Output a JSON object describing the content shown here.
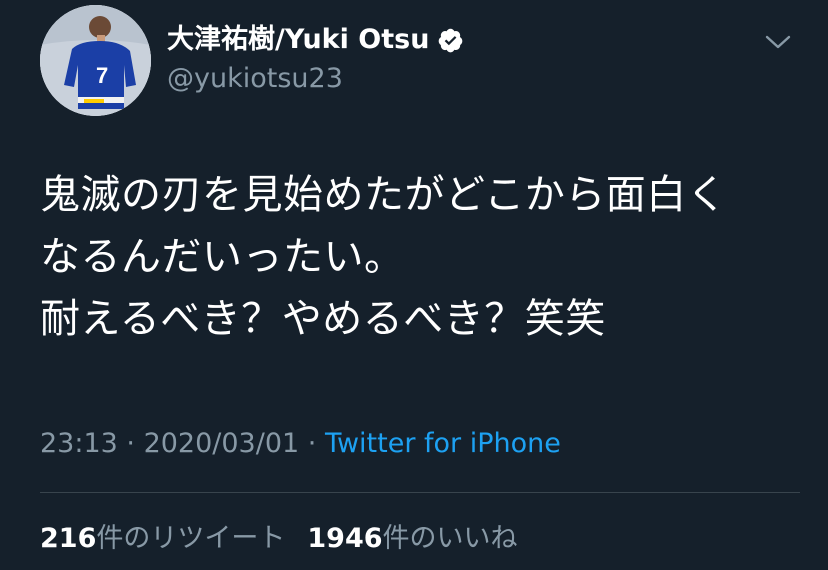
{
  "author": {
    "display_name": "大津祐樹/Yuki Otsu",
    "handle": "@yukiotsu23",
    "verified_icon": "verified-badge-icon",
    "avatar_icon": "player-avatar"
  },
  "tweet": {
    "lines": [
      "鬼滅の刃を見始めたがどこから面白く",
      "なるんだいったい。",
      "耐えるべき？やめるべき？笑笑"
    ]
  },
  "meta": {
    "time": "23:13",
    "sep1": " · ",
    "date": "2020/03/01",
    "sep2": " · ",
    "source": "Twitter for iPhone"
  },
  "stats": {
    "retweets_count": "216",
    "retweets_label": "件のリツイート",
    "likes_count": "1946",
    "likes_label": "件のいいね"
  },
  "colors": {
    "background": "#15202b",
    "secondary_text": "#8899a6",
    "link": "#1da1f2",
    "divider": "#38444d"
  }
}
